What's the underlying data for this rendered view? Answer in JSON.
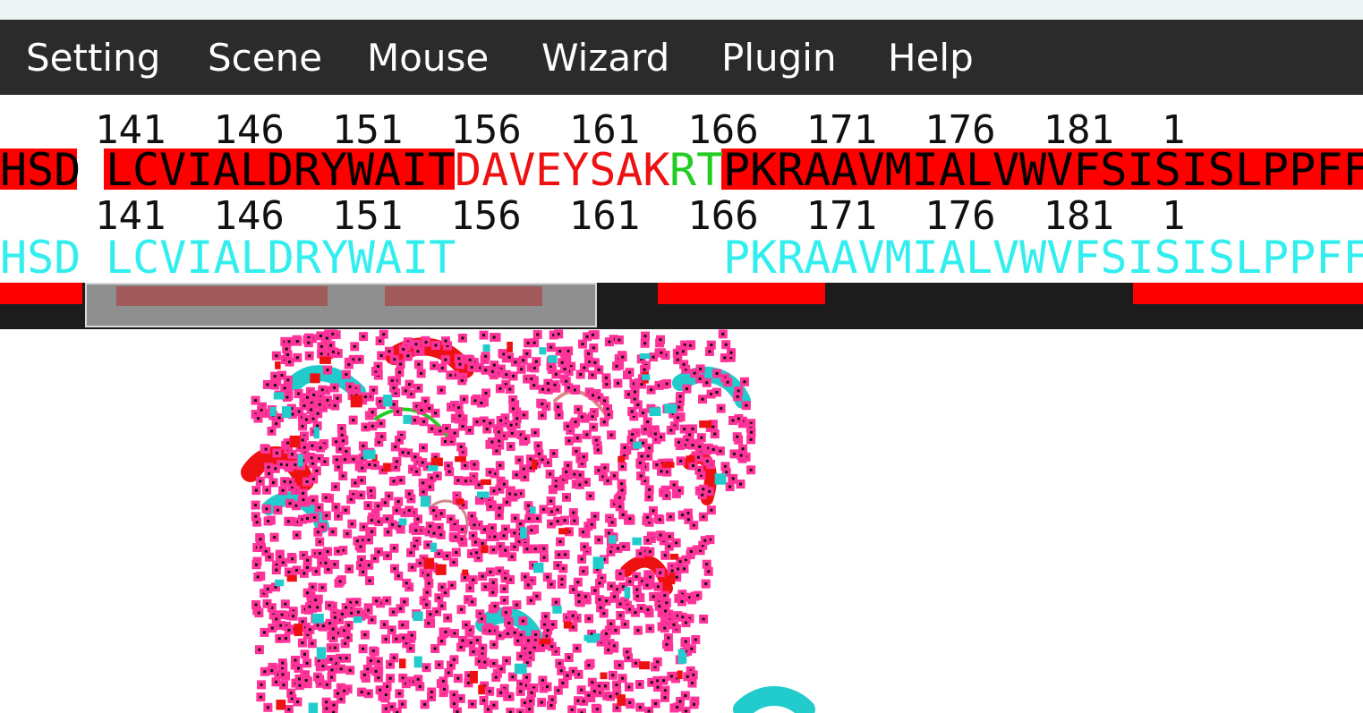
{
  "menu": {
    "items": [
      "Setting",
      "Scene",
      "Mouse",
      "Wizard",
      "Plugin",
      "Help"
    ]
  },
  "sequence": {
    "row1_numbers": "    141  146  151  156  161  166  171  176  181  1",
    "row1_prefix": "HSD",
    "row1_block1": "LCVIALDRYWAIT",
    "row1_mid_a": "DAV",
    "row1_mid_b": "EYSAK",
    "row1_mid_c": "RT",
    "row1_block2": "PKRAAVMIALVWVFSISISLPPFF",
    "row2_numbers": "    141  146  151  156  161  166  171  176  181  1",
    "row2_prefix": "HSD",
    "row2_block1": "LCVIALDRYWAIT",
    "row2_block2": "PKRAAVMIALVWVFSISISLPPFF"
  },
  "colors": {
    "menu_bg": "#2b2b2b",
    "highlight_red": "#ff0000",
    "cyan_text": "#33eeee",
    "green_text": "#22cc22",
    "red_text": "#ee1111",
    "atom_pink": "#ff3399",
    "helix_cyan": "#22cccc",
    "helix_red": "#ee1111"
  }
}
